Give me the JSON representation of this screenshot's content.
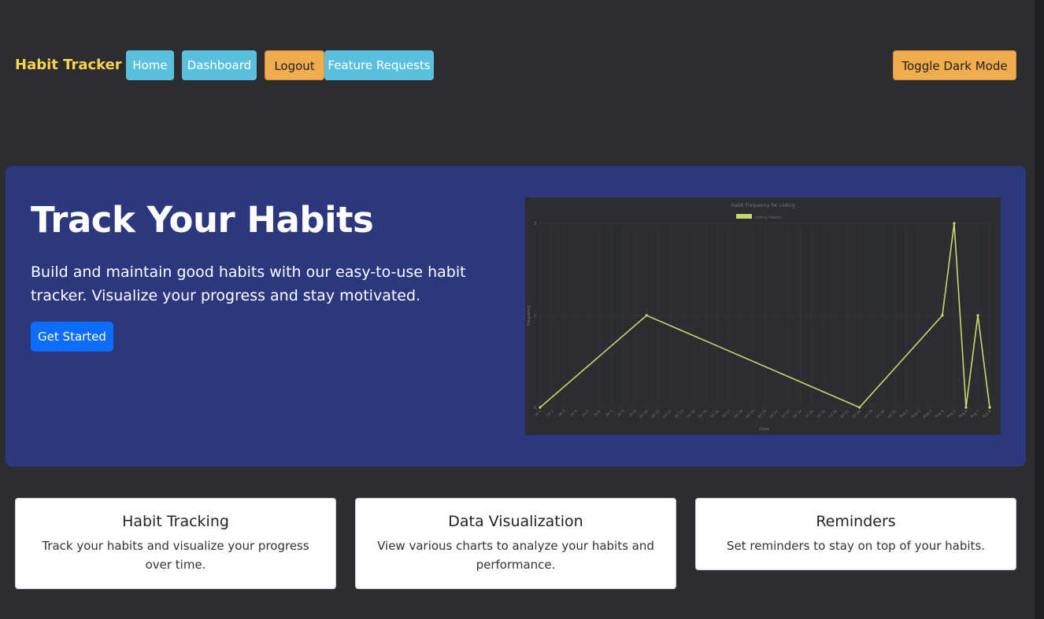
{
  "nav": {
    "brand": "Habit Tracker",
    "items": [
      {
        "label": "Home",
        "style": "info"
      },
      {
        "label": "Dashboard",
        "style": "info"
      },
      {
        "label": "Logout",
        "style": "warn"
      },
      {
        "label": "Feature Requests",
        "style": "info"
      }
    ],
    "toggle_label": "Toggle Dark Mode"
  },
  "hero": {
    "title": "Track Your Habits",
    "text": "Build and maintain good habits with our easy-to-use habit tracker. Visualize your progress and stay motivated.",
    "cta_label": "Get Started"
  },
  "chart_data": {
    "type": "line",
    "title": "Habit Frequency for coding",
    "xlabel": "Date",
    "ylabel": "Frequency",
    "series": [
      {
        "name": "coding Habits",
        "color": "#c8d86a",
        "values": [
          1,
          2,
          1,
          2,
          3,
          1,
          2,
          1
        ]
      }
    ],
    "x": [
      "Jul 1",
      "Jul 10",
      "Jul 28",
      "Aug 4",
      "Aug 5",
      "Aug 6",
      "Aug 7",
      "Aug 8"
    ],
    "x_ticks": [
      "Jul 1",
      "Jul 2",
      "Jul 3",
      "Jul 4",
      "Jul 5",
      "Jul 6",
      "Jul 7",
      "Jul 8",
      "Jul 9",
      "Jul 10",
      "Jul 11",
      "Jul 12",
      "Jul 13",
      "Jul 14",
      "Jul 15",
      "Jul 16",
      "Jul 17",
      "Jul 18",
      "Jul 19",
      "Jul 20",
      "Jul 21",
      "Jul 22",
      "Jul 23",
      "Jul 24",
      "Jul 25",
      "Jul 26",
      "Jul 27",
      "Jul 28",
      "Jul 29",
      "Jul 30",
      "Jul 31",
      "Aug 1",
      "Aug 2",
      "Aug 3",
      "Aug 4",
      "Aug 5",
      "Aug 6",
      "Aug 7",
      "Aug 8"
    ],
    "y_ticks": [
      1,
      2,
      3
    ],
    "ylim": [
      1,
      3
    ],
    "grid": true,
    "legend": "top"
  },
  "cards": [
    {
      "title": "Habit Tracking",
      "text": "Track your habits and visualize your progress over time."
    },
    {
      "title": "Data Visualization",
      "text": "View various charts to analyze your habits and performance."
    },
    {
      "title": "Reminders",
      "text": "Set reminders to stay on top of your habits."
    }
  ]
}
